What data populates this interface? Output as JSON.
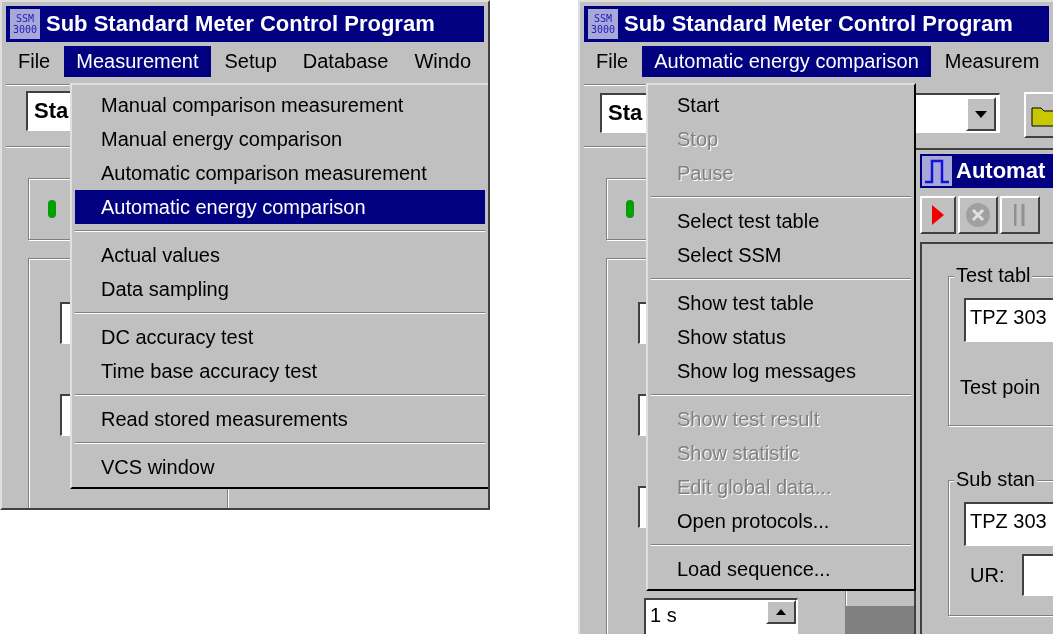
{
  "windows": [
    {
      "title": "Sub Standard Meter Control Program",
      "icon_text": [
        "SSM",
        "3000"
      ],
      "menu_bar": [
        {
          "label": "File",
          "selected": false
        },
        {
          "label": "Measurement",
          "selected": true
        },
        {
          "label": "Setup",
          "selected": false
        },
        {
          "label": "Database",
          "selected": false
        },
        {
          "label": "Windo",
          "selected": false
        }
      ],
      "combo_value": "Sta",
      "dropdown": [
        [
          {
            "label": "Manual comparison measurement",
            "selected": false,
            "disabled": false
          },
          {
            "label": "Manual energy comparison",
            "selected": false,
            "disabled": false
          },
          {
            "label": "Automatic comparison measurement",
            "selected": false,
            "disabled": false
          },
          {
            "label": "Automatic energy comparison",
            "selected": true,
            "disabled": false
          }
        ],
        [
          {
            "label": "Actual values",
            "selected": false,
            "disabled": false
          },
          {
            "label": "Data sampling",
            "selected": false,
            "disabled": false
          }
        ],
        [
          {
            "label": "DC accuracy test",
            "selected": false,
            "disabled": false
          },
          {
            "label": "Time base accuracy test",
            "selected": false,
            "disabled": false
          }
        ],
        [
          {
            "label": "Read stored measurements",
            "selected": false,
            "disabled": false
          }
        ],
        [
          {
            "label": "VCS window",
            "selected": false,
            "disabled": false
          }
        ]
      ]
    },
    {
      "title": "Sub Standard Meter Control Program",
      "icon_text": [
        "SSM",
        "3000"
      ],
      "menu_bar": [
        {
          "label": "File",
          "selected": false
        },
        {
          "label": "Automatic energy comparison",
          "selected": true
        },
        {
          "label": "Measurem",
          "selected": false
        }
      ],
      "combo_value": "Sta",
      "dropdown": [
        [
          {
            "label": "Start",
            "selected": false,
            "disabled": false
          },
          {
            "label": "Stop",
            "selected": false,
            "disabled": true
          },
          {
            "label": "Pause",
            "selected": false,
            "disabled": true
          }
        ],
        [
          {
            "label": "Select test table",
            "selected": false,
            "disabled": false
          },
          {
            "label": "Select SSM",
            "selected": false,
            "disabled": false
          }
        ],
        [
          {
            "label": "Show test table",
            "selected": false,
            "disabled": false
          },
          {
            "label": "Show status",
            "selected": false,
            "disabled": false
          },
          {
            "label": "Show log messages",
            "selected": false,
            "disabled": false
          }
        ],
        [
          {
            "label": "Show test result",
            "selected": false,
            "disabled": true
          },
          {
            "label": "Show statistic",
            "selected": false,
            "disabled": true
          },
          {
            "label": "Edit global data...",
            "selected": false,
            "disabled": true
          },
          {
            "label": "Open protocols...",
            "selected": false,
            "disabled": false
          }
        ],
        [
          {
            "label": "Load sequence...",
            "selected": false,
            "disabled": false
          }
        ]
      ],
      "child_window": {
        "title": "Automat",
        "groups": [
          {
            "label": "Test tabl",
            "field": "TPZ 303",
            "note": "Test poin"
          },
          {
            "label": "Sub stan",
            "field": "TPZ 303",
            "note": "UR:"
          }
        ]
      },
      "bottom_field": "1 s"
    }
  ]
}
